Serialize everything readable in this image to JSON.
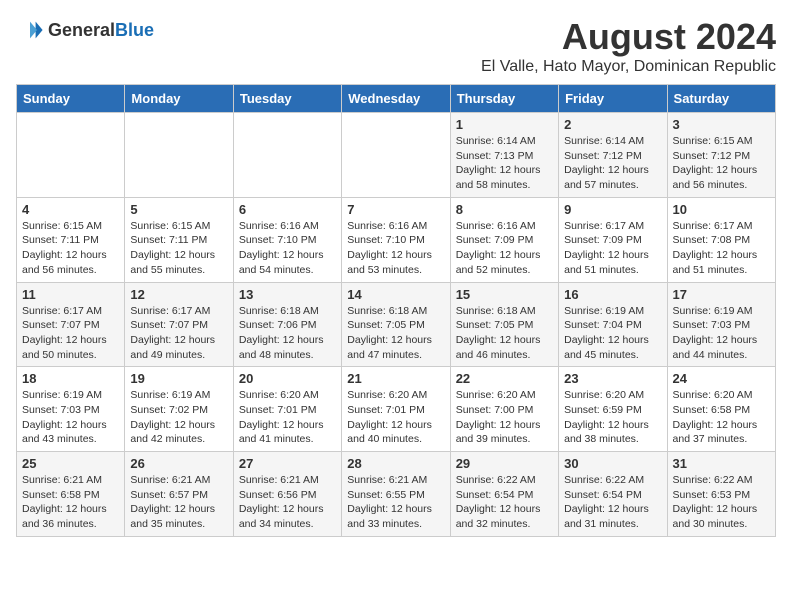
{
  "header": {
    "logo_general": "General",
    "logo_blue": "Blue",
    "month_year": "August 2024",
    "location": "El Valle, Hato Mayor, Dominican Republic"
  },
  "days_of_week": [
    "Sunday",
    "Monday",
    "Tuesday",
    "Wednesday",
    "Thursday",
    "Friday",
    "Saturday"
  ],
  "weeks": [
    [
      {
        "day": "",
        "content": ""
      },
      {
        "day": "",
        "content": ""
      },
      {
        "day": "",
        "content": ""
      },
      {
        "day": "",
        "content": ""
      },
      {
        "day": "1",
        "content": "Sunrise: 6:14 AM\nSunset: 7:13 PM\nDaylight: 12 hours\nand 58 minutes."
      },
      {
        "day": "2",
        "content": "Sunrise: 6:14 AM\nSunset: 7:12 PM\nDaylight: 12 hours\nand 57 minutes."
      },
      {
        "day": "3",
        "content": "Sunrise: 6:15 AM\nSunset: 7:12 PM\nDaylight: 12 hours\nand 56 minutes."
      }
    ],
    [
      {
        "day": "4",
        "content": "Sunrise: 6:15 AM\nSunset: 7:11 PM\nDaylight: 12 hours\nand 56 minutes."
      },
      {
        "day": "5",
        "content": "Sunrise: 6:15 AM\nSunset: 7:11 PM\nDaylight: 12 hours\nand 55 minutes."
      },
      {
        "day": "6",
        "content": "Sunrise: 6:16 AM\nSunset: 7:10 PM\nDaylight: 12 hours\nand 54 minutes."
      },
      {
        "day": "7",
        "content": "Sunrise: 6:16 AM\nSunset: 7:10 PM\nDaylight: 12 hours\nand 53 minutes."
      },
      {
        "day": "8",
        "content": "Sunrise: 6:16 AM\nSunset: 7:09 PM\nDaylight: 12 hours\nand 52 minutes."
      },
      {
        "day": "9",
        "content": "Sunrise: 6:17 AM\nSunset: 7:09 PM\nDaylight: 12 hours\nand 51 minutes."
      },
      {
        "day": "10",
        "content": "Sunrise: 6:17 AM\nSunset: 7:08 PM\nDaylight: 12 hours\nand 51 minutes."
      }
    ],
    [
      {
        "day": "11",
        "content": "Sunrise: 6:17 AM\nSunset: 7:07 PM\nDaylight: 12 hours\nand 50 minutes."
      },
      {
        "day": "12",
        "content": "Sunrise: 6:17 AM\nSunset: 7:07 PM\nDaylight: 12 hours\nand 49 minutes."
      },
      {
        "day": "13",
        "content": "Sunrise: 6:18 AM\nSunset: 7:06 PM\nDaylight: 12 hours\nand 48 minutes."
      },
      {
        "day": "14",
        "content": "Sunrise: 6:18 AM\nSunset: 7:05 PM\nDaylight: 12 hours\nand 47 minutes."
      },
      {
        "day": "15",
        "content": "Sunrise: 6:18 AM\nSunset: 7:05 PM\nDaylight: 12 hours\nand 46 minutes."
      },
      {
        "day": "16",
        "content": "Sunrise: 6:19 AM\nSunset: 7:04 PM\nDaylight: 12 hours\nand 45 minutes."
      },
      {
        "day": "17",
        "content": "Sunrise: 6:19 AM\nSunset: 7:03 PM\nDaylight: 12 hours\nand 44 minutes."
      }
    ],
    [
      {
        "day": "18",
        "content": "Sunrise: 6:19 AM\nSunset: 7:03 PM\nDaylight: 12 hours\nand 43 minutes."
      },
      {
        "day": "19",
        "content": "Sunrise: 6:19 AM\nSunset: 7:02 PM\nDaylight: 12 hours\nand 42 minutes."
      },
      {
        "day": "20",
        "content": "Sunrise: 6:20 AM\nSunset: 7:01 PM\nDaylight: 12 hours\nand 41 minutes."
      },
      {
        "day": "21",
        "content": "Sunrise: 6:20 AM\nSunset: 7:01 PM\nDaylight: 12 hours\nand 40 minutes."
      },
      {
        "day": "22",
        "content": "Sunrise: 6:20 AM\nSunset: 7:00 PM\nDaylight: 12 hours\nand 39 minutes."
      },
      {
        "day": "23",
        "content": "Sunrise: 6:20 AM\nSunset: 6:59 PM\nDaylight: 12 hours\nand 38 minutes."
      },
      {
        "day": "24",
        "content": "Sunrise: 6:20 AM\nSunset: 6:58 PM\nDaylight: 12 hours\nand 37 minutes."
      }
    ],
    [
      {
        "day": "25",
        "content": "Sunrise: 6:21 AM\nSunset: 6:58 PM\nDaylight: 12 hours\nand 36 minutes."
      },
      {
        "day": "26",
        "content": "Sunrise: 6:21 AM\nSunset: 6:57 PM\nDaylight: 12 hours\nand 35 minutes."
      },
      {
        "day": "27",
        "content": "Sunrise: 6:21 AM\nSunset: 6:56 PM\nDaylight: 12 hours\nand 34 minutes."
      },
      {
        "day": "28",
        "content": "Sunrise: 6:21 AM\nSunset: 6:55 PM\nDaylight: 12 hours\nand 33 minutes."
      },
      {
        "day": "29",
        "content": "Sunrise: 6:22 AM\nSunset: 6:54 PM\nDaylight: 12 hours\nand 32 minutes."
      },
      {
        "day": "30",
        "content": "Sunrise: 6:22 AM\nSunset: 6:54 PM\nDaylight: 12 hours\nand 31 minutes."
      },
      {
        "day": "31",
        "content": "Sunrise: 6:22 AM\nSunset: 6:53 PM\nDaylight: 12 hours\nand 30 minutes."
      }
    ]
  ]
}
